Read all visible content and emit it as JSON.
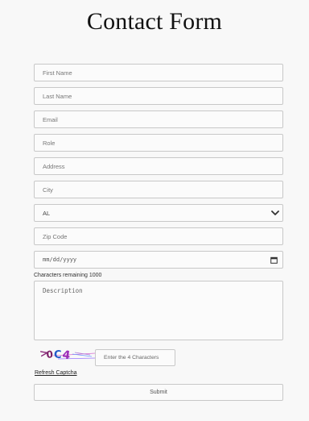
{
  "page": {
    "title": "Contact Form"
  },
  "form": {
    "first_name": {
      "placeholder": "First Name"
    },
    "last_name": {
      "placeholder": "Last Name"
    },
    "email": {
      "placeholder": "Email"
    },
    "role": {
      "placeholder": "Role"
    },
    "address": {
      "placeholder": "Address"
    },
    "city": {
      "placeholder": "City"
    },
    "state": {
      "selected": "AL",
      "icon": "chevron-down-icon"
    },
    "zip": {
      "placeholder": "Zip Code"
    },
    "date": {
      "placeholder": "mm/dd/yyyy",
      "icon": "calendar-icon"
    },
    "description": {
      "counter_text": "Characters remaining 1000",
      "placeholder": "Description"
    },
    "captcha": {
      "characters": [
        ">",
        "0",
        "C",
        "4"
      ],
      "character_colors": [
        "#8a2c7a",
        "#7a1f66",
        "#1f59c9",
        "#9b2db8"
      ],
      "input_placeholder": "Enter the 4 Characters",
      "refresh_label": "Refresh Captcha"
    },
    "submit_label": "Submit"
  }
}
